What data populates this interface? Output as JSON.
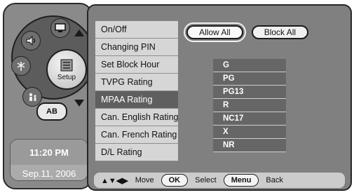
{
  "left_panel": {
    "setup_label": "Setup",
    "ab_label": "AB",
    "clock_time": "11:20 PM",
    "clock_date": "Sep.11, 2006"
  },
  "menu": {
    "items": [
      {
        "label": "On/Off"
      },
      {
        "label": "Changing PIN"
      },
      {
        "label": "Set Block Hour"
      },
      {
        "label": "TVPG Rating"
      },
      {
        "label": "MPAA Rating",
        "selected": true
      },
      {
        "label": "Can. English Rating"
      },
      {
        "label": "Can. French Rating"
      },
      {
        "label": "D/L Rating"
      }
    ]
  },
  "buttons": {
    "allow_all": "Allow All",
    "block_all": "Block All"
  },
  "ratings": [
    "G",
    "PG",
    "PG13",
    "R",
    "NC17",
    "X",
    "NR"
  ],
  "footer": {
    "move_arrows": "▲▼◀▶",
    "move_label": "Move",
    "ok_key": "OK",
    "select_label": "Select",
    "menu_key": "Menu",
    "back_label": "Back"
  }
}
